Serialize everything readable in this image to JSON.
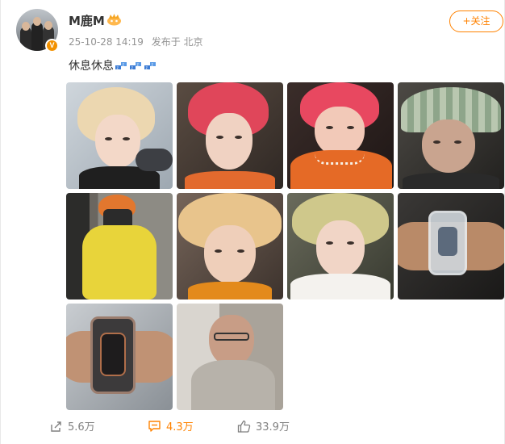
{
  "author": {
    "name": "M鹿M",
    "verified_badge": "V",
    "avatar_icon": "avatar-group-photo",
    "vip_icon": "crown-vip-icon"
  },
  "meta": {
    "timestamp": "25-10-28 14:19",
    "location": "发布于 北京"
  },
  "follow_button": {
    "label": "+关注"
  },
  "post": {
    "text": "休息休息",
    "emoji_icon": "zzz-sleep-emoji"
  },
  "photos": [
    {
      "desc": "blonde-hair-selfie"
    },
    {
      "desc": "red-hair-selfie"
    },
    {
      "desc": "red-hair-pearl-necklace"
    },
    {
      "desc": "knit-bucket-hat-selfie"
    },
    {
      "desc": "mirror-selfie-yellow-shirt"
    },
    {
      "desc": "blonde-hair-closeup"
    },
    {
      "desc": "green-blonde-hair-closeup"
    },
    {
      "desc": "transparent-watch-on-wrist"
    },
    {
      "desc": "skeleton-watch-on-wrist"
    },
    {
      "desc": "sleeping-on-plane"
    }
  ],
  "footer": {
    "share_count": "5.6万",
    "comment_count": "4.3万",
    "like_count": "33.9万"
  },
  "colors": {
    "accent": "#ff8200",
    "meta_gray": "#939393",
    "verified": "#f29100"
  }
}
